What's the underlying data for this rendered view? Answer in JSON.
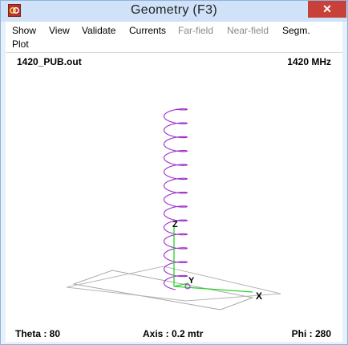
{
  "window": {
    "title": "Geometry    (F3)"
  },
  "menu": {
    "row1": [
      {
        "label": "Show",
        "enabled": true
      },
      {
        "label": "View",
        "enabled": true
      },
      {
        "label": "Validate",
        "enabled": true
      },
      {
        "label": "Currents",
        "enabled": true
      },
      {
        "label": "Far-field",
        "enabled": false
      },
      {
        "label": "Near-field",
        "enabled": false
      },
      {
        "label": "Segm.",
        "enabled": true
      }
    ],
    "row2": [
      {
        "label": "Plot",
        "enabled": true
      }
    ]
  },
  "header": {
    "filename": "1420_PUB.out",
    "frequency": "1420 MHz"
  },
  "footer": {
    "theta": "Theta : 80",
    "axis": "Axis : 0.2 mtr",
    "phi": "Phi : 280"
  },
  "axes": {
    "x": "X",
    "y": "Y",
    "z": "Z"
  },
  "colors": {
    "helix": "#9b2fc9",
    "axis_z": "#2ad42a",
    "axis_x": "#2ad42a",
    "ground": "#a8a8a8",
    "close_button": "#c7413a"
  },
  "icons": {
    "app": "nec-geometry-icon",
    "close": "close-icon"
  }
}
